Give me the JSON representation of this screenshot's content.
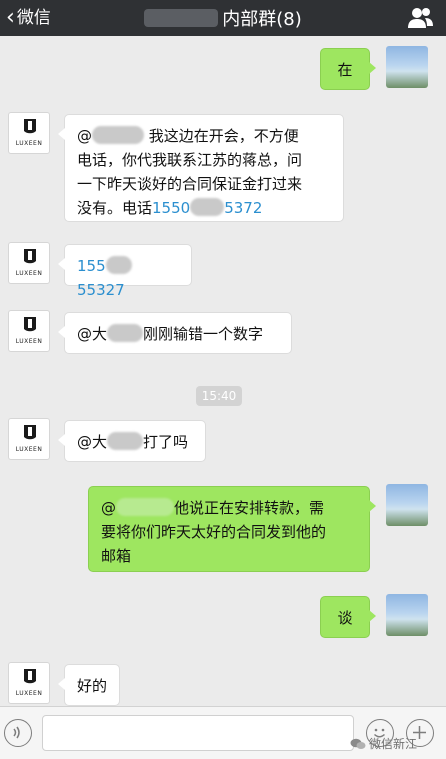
{
  "header": {
    "back_label": "微信",
    "title": "内部群(8)"
  },
  "avatar_logo_text": "LUXEEN",
  "messages": [
    {
      "side": "right",
      "text": "在"
    },
    {
      "side": "left",
      "mention": "@",
      "line1_after": "我这边在开会，不方便",
      "line2": "电话，你代我联系江苏的蒋总，问",
      "line3": "一下昨天谈好的合同保证金打过来",
      "line4_before": "没有。电话",
      "phone_start": "1550",
      "phone_end": "5372"
    },
    {
      "side": "left",
      "phone_start": "155",
      "phone_end": "55327"
    },
    {
      "side": "left",
      "mention": "@大",
      "text_after": "刚刚输错一个数字"
    },
    {
      "side": "left",
      "mention": "@大",
      "text_after": "打了吗"
    },
    {
      "side": "right",
      "mention": "@",
      "line1_after": "他说正在安排转款，需",
      "line2": "要将你们昨天太好的合同发到他的",
      "line3": "邮箱"
    },
    {
      "side": "right",
      "text": "谈"
    },
    {
      "side": "left",
      "text": "好的"
    }
  ],
  "timestamp": "15:40",
  "input": {
    "placeholder": ""
  },
  "watermark": "微信新江",
  "icons": {
    "group": "group-members-icon",
    "voice": "voice-icon",
    "emoji": "emoji-icon",
    "plus": "add-icon",
    "back": "chevron-left-icon"
  },
  "colors": {
    "header": "#2f3134",
    "background": "#ebebeb",
    "self_bubble": "#9ee660",
    "other_bubble": "#ffffff",
    "link": "#2b8fcf"
  }
}
